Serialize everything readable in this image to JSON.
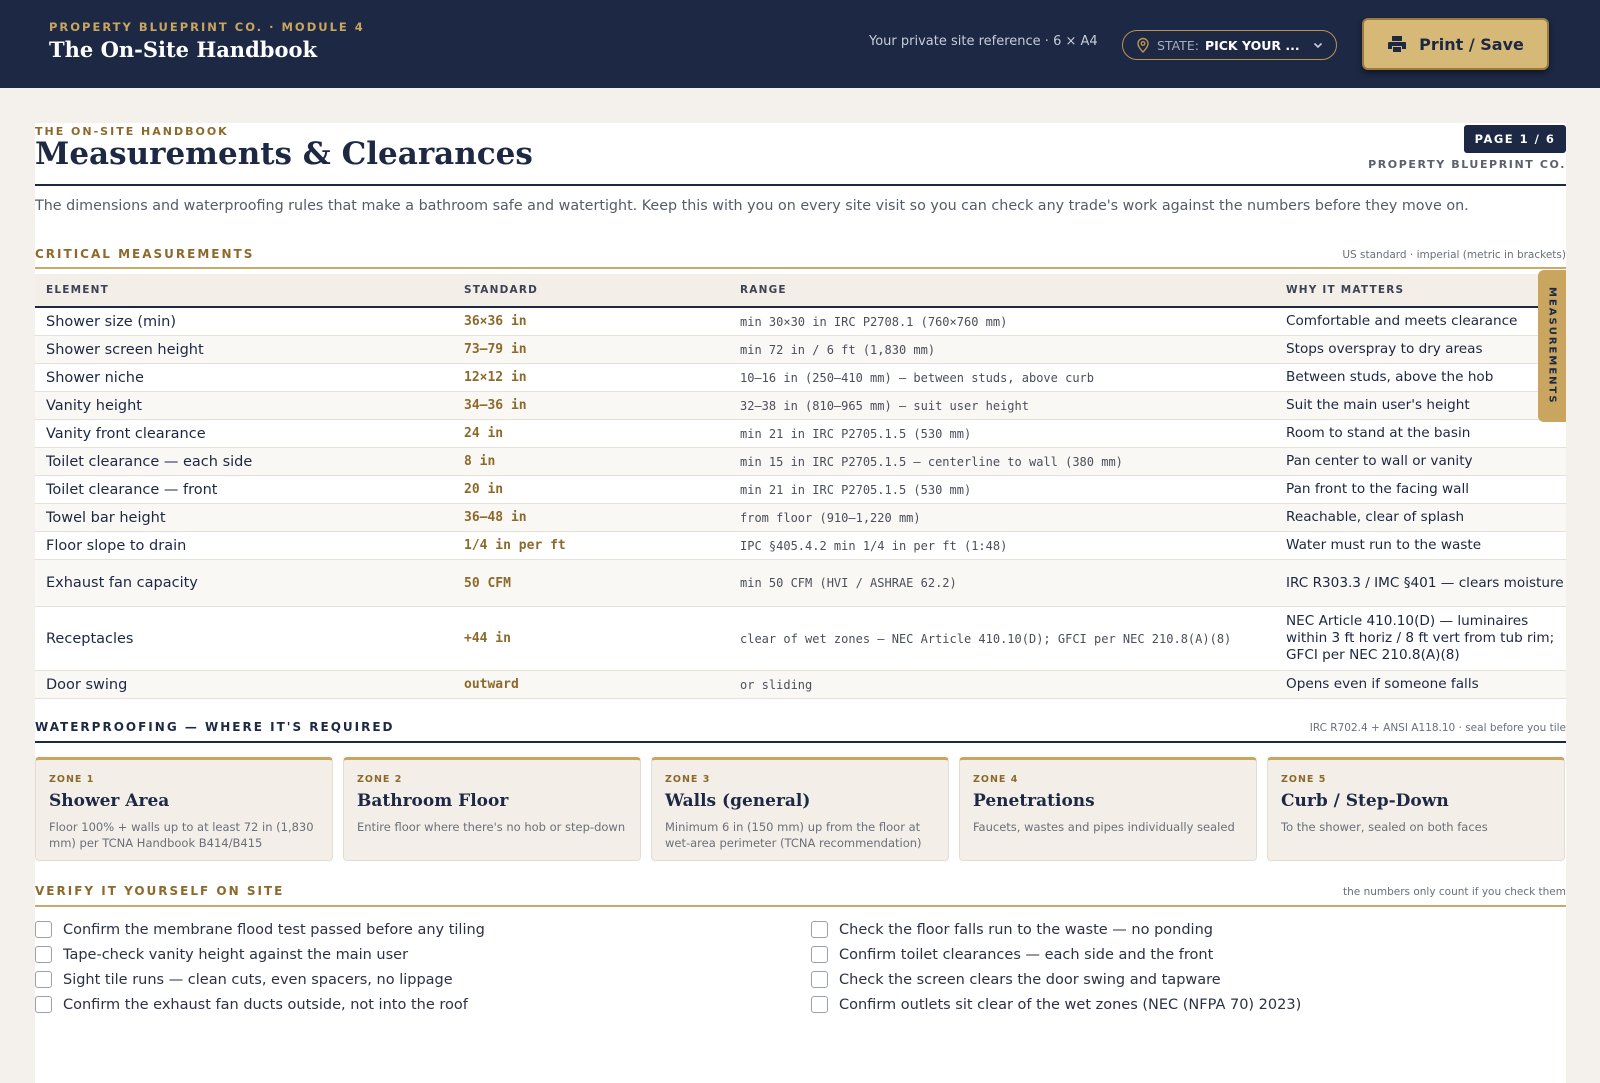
{
  "topbar": {
    "kicker": "PROPERTY BLUEPRINT CO. · MODULE 4",
    "title": "The On-Site Handbook",
    "site_ref": "Your private site reference · 6 × A4",
    "state_label": "STATE:",
    "state_value": "PICK YOUR ...",
    "print_label": "Print / Save"
  },
  "doc": {
    "kicker": "THE ON-SITE HANDBOOK",
    "title": "Measurements & Clearances",
    "page": "PAGE  1  /  6",
    "company": "PROPERTY BLUEPRINT CO.",
    "intro": "The dimensions and waterproofing rules that make a bathroom safe and watertight. Keep this with you on every site visit so you can check any trade's work against the numbers before they move on."
  },
  "measurements": {
    "title": "CRITICAL MEASUREMENTS",
    "note": "US standard · imperial (metric in brackets)",
    "side_tab": "MEASUREMENTS",
    "headers": [
      "ELEMENT",
      "STANDARD",
      "RANGE",
      "WHY IT MATTERS"
    ],
    "rows": [
      {
        "element": "Shower size (min)",
        "standard": "36×36 in",
        "range": "min 30×30 in IRC P2708.1 (760×760 mm)",
        "why": "Comfortable and meets clearance"
      },
      {
        "element": "Shower screen height",
        "standard": "73–79 in",
        "range": "min 72 in / 6 ft (1,830 mm)",
        "why": "Stops overspray to dry areas"
      },
      {
        "element": "Shower niche",
        "standard": "12×12 in",
        "range": "10–16 in (250–410 mm) — between studs, above curb",
        "why": "Between studs, above the hob"
      },
      {
        "element": "Vanity height",
        "standard": "34–36 in",
        "range": "32–38 in (810–965 mm) — suit user height",
        "why": "Suit the main user's height"
      },
      {
        "element": "Vanity front clearance",
        "standard": "24 in",
        "range": "min 21 in IRC P2705.1.5 (530 mm)",
        "why": "Room to stand at the basin"
      },
      {
        "element": "Toilet clearance — each side",
        "standard": "8 in",
        "range": "min 15 in IRC P2705.1.5 — centerline to wall (380 mm)",
        "why": "Pan center to wall or vanity"
      },
      {
        "element": "Toilet clearance — front",
        "standard": "20 in",
        "range": "min 21 in IRC P2705.1.5 (530 mm)",
        "why": "Pan front to the facing wall"
      },
      {
        "element": "Towel bar height",
        "standard": "36–48 in",
        "range": "from floor (910–1,220 mm)",
        "why": "Reachable, clear of splash"
      },
      {
        "element": "Floor slope to drain",
        "standard": "1/4 in per ft",
        "range": "IPC §405.4.2 min 1/4 in per ft (1:48)",
        "why": "Water must run to the waste"
      },
      {
        "element": "Exhaust fan capacity",
        "standard": "50 CFM",
        "range": "min 50 CFM (HVI / ASHRAE 62.2)",
        "why": "IRC R303.3 / IMC §401 — clears moisture"
      },
      {
        "element": "Receptacles",
        "standard": "+44 in",
        "range": "clear of wet zones — NEC Article 410.10(D); GFCI per NEC 210.8(A)(8)",
        "why": "NEC Article 410.10(D) — luminaires within 3 ft horiz / 8 ft vert from tub rim; GFCI per NEC 210.8(A)(8)"
      },
      {
        "element": "Door swing",
        "standard": "outward",
        "range": "or sliding",
        "why": "Opens even if someone falls"
      }
    ]
  },
  "waterproofing": {
    "title": "WATERPROOFING — WHERE IT'S REQUIRED",
    "note": "IRC R702.4 + ANSI A118.10 · seal before you tile",
    "zones": [
      {
        "num": "ZONE 1",
        "name": "Shower Area",
        "desc": "Floor 100% + walls up to at least 72 in (1,830 mm) per TCNA Handbook B414/B415"
      },
      {
        "num": "ZONE 2",
        "name": "Bathroom Floor",
        "desc": "Entire floor where there's no hob or step-down"
      },
      {
        "num": "ZONE 3",
        "name": "Walls (general)",
        "desc": "Minimum 6 in (150 mm) up from the floor at wet-area perimeter (TCNA recommendation)"
      },
      {
        "num": "ZONE 4",
        "name": "Penetrations",
        "desc": "Faucets, wastes and pipes individually sealed"
      },
      {
        "num": "ZONE 5",
        "name": "Curb / Step-Down",
        "desc": "To the shower, sealed on both faces"
      }
    ]
  },
  "verify": {
    "title": "VERIFY IT YOURSELF ON SITE",
    "note": "the numbers only count if you check them",
    "items": [
      "Confirm the membrane flood test passed before any tiling",
      "Tape-check vanity height against the main user",
      "Sight tile runs — clean cuts, even spacers, no lippage",
      "Confirm the exhaust fan ducts outside, not into the roof",
      "Check the floor falls run to the waste — no ponding",
      "Confirm toilet clearances — each side and the front",
      "Check the screen clears the door swing and tapware",
      "Confirm outlets sit clear of the wet zones (NEC (NFPA 70) 2023)"
    ]
  },
  "colors": {
    "navy": "#1c2844",
    "gold": "#c9a560",
    "gold_dark": "#8c6a2b",
    "paper": "#f4f1ec"
  },
  "icons": {
    "state": "map-pin-icon",
    "dropdown": "chevron-down-icon",
    "print": "printer-icon"
  }
}
